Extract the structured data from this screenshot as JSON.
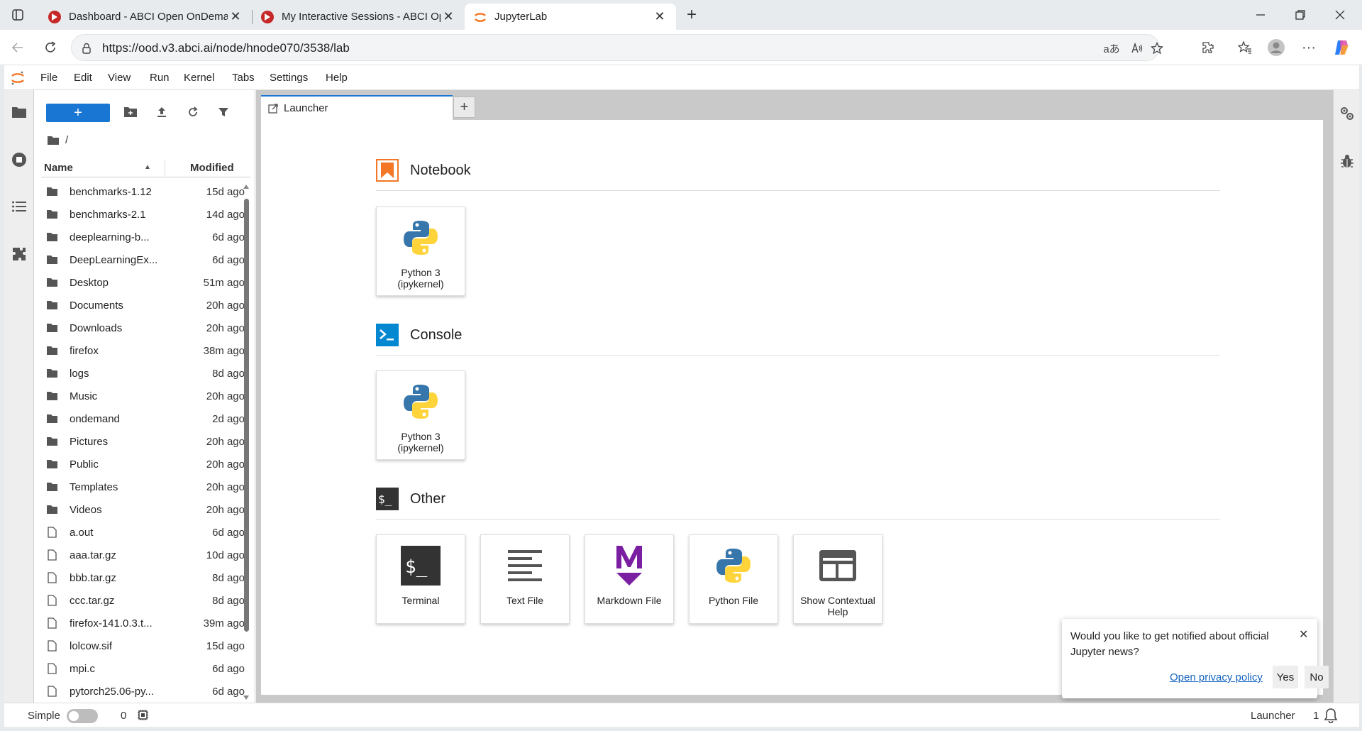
{
  "browser": {
    "tabs": [
      {
        "title": "Dashboard - ABCI Open OnDemand"
      },
      {
        "title": "My Interactive Sessions - ABCI Open OnDemand"
      },
      {
        "title": "JupyterLab"
      }
    ],
    "url": "https://ood.v3.abci.ai/node/hnode070/3538/lab",
    "translate_glyph": "aあ",
    "read_aloud_glyph": "A ))"
  },
  "jupyter": {
    "menu": [
      "File",
      "Edit",
      "View",
      "Run",
      "Kernel",
      "Tabs",
      "Settings",
      "Help"
    ],
    "breadcrumb": "/",
    "columns": {
      "name": "Name",
      "modified": "Modified"
    },
    "files": [
      {
        "name": "benchmarks-1.12",
        "modified": "15d ago",
        "type": "folder"
      },
      {
        "name": "benchmarks-2.1",
        "modified": "14d ago",
        "type": "folder"
      },
      {
        "name": "deeplearning-b...",
        "modified": "6d ago",
        "type": "folder"
      },
      {
        "name": "DeepLearningEx...",
        "modified": "6d ago",
        "type": "folder"
      },
      {
        "name": "Desktop",
        "modified": "51m ago",
        "type": "folder"
      },
      {
        "name": "Documents",
        "modified": "20h ago",
        "type": "folder"
      },
      {
        "name": "Downloads",
        "modified": "20h ago",
        "type": "folder"
      },
      {
        "name": "firefox",
        "modified": "38m ago",
        "type": "folder"
      },
      {
        "name": "logs",
        "modified": "8d ago",
        "type": "folder"
      },
      {
        "name": "Music",
        "modified": "20h ago",
        "type": "folder"
      },
      {
        "name": "ondemand",
        "modified": "2d ago",
        "type": "folder"
      },
      {
        "name": "Pictures",
        "modified": "20h ago",
        "type": "folder"
      },
      {
        "name": "Public",
        "modified": "20h ago",
        "type": "folder"
      },
      {
        "name": "Templates",
        "modified": "20h ago",
        "type": "folder"
      },
      {
        "name": "Videos",
        "modified": "20h ago",
        "type": "folder"
      },
      {
        "name": "a.out",
        "modified": "6d ago",
        "type": "file"
      },
      {
        "name": "aaa.tar.gz",
        "modified": "10d ago",
        "type": "file"
      },
      {
        "name": "bbb.tar.gz",
        "modified": "8d ago",
        "type": "file"
      },
      {
        "name": "ccc.tar.gz",
        "modified": "8d ago",
        "type": "file"
      },
      {
        "name": "firefox-141.0.3.t...",
        "modified": "39m ago",
        "type": "file"
      },
      {
        "name": "lolcow.sif",
        "modified": "15d ago",
        "type": "file"
      },
      {
        "name": "mpi.c",
        "modified": "6d ago",
        "type": "file"
      },
      {
        "name": "pytorch25.06-py...",
        "modified": "6d ago",
        "type": "file"
      }
    ],
    "doc_tab": "Launcher",
    "launcher": {
      "notebook": {
        "title": "Notebook",
        "cards": [
          {
            "label": "Python 3 (ipykernel)",
            "icon": "python-icon"
          }
        ]
      },
      "console": {
        "title": "Console",
        "cards": [
          {
            "label": "Python 3 (ipykernel)",
            "icon": "python-icon"
          }
        ]
      },
      "other": {
        "title": "Other",
        "cards": [
          {
            "label": "Terminal",
            "icon": "terminal-icon"
          },
          {
            "label": "Text File",
            "icon": "text-file-icon"
          },
          {
            "label": "Markdown File",
            "icon": "markdown-icon"
          },
          {
            "label": "Python File",
            "icon": "python-icon"
          },
          {
            "label": "Show Contextual Help",
            "icon": "contextual-help-icon"
          }
        ]
      }
    },
    "notification": {
      "message": "Would you like to get notified about official Jupyter news?",
      "link": "Open privacy policy",
      "yes": "Yes",
      "no": "No"
    },
    "status": {
      "mode": "Simple",
      "kernels": "0",
      "current": "Launcher",
      "count": "1"
    }
  },
  "colors": {
    "brand": "#1976d2",
    "jupyter_orange": "#f37726",
    "console_blue": "#0288d1",
    "markdown_purple": "#7b1fa2"
  }
}
